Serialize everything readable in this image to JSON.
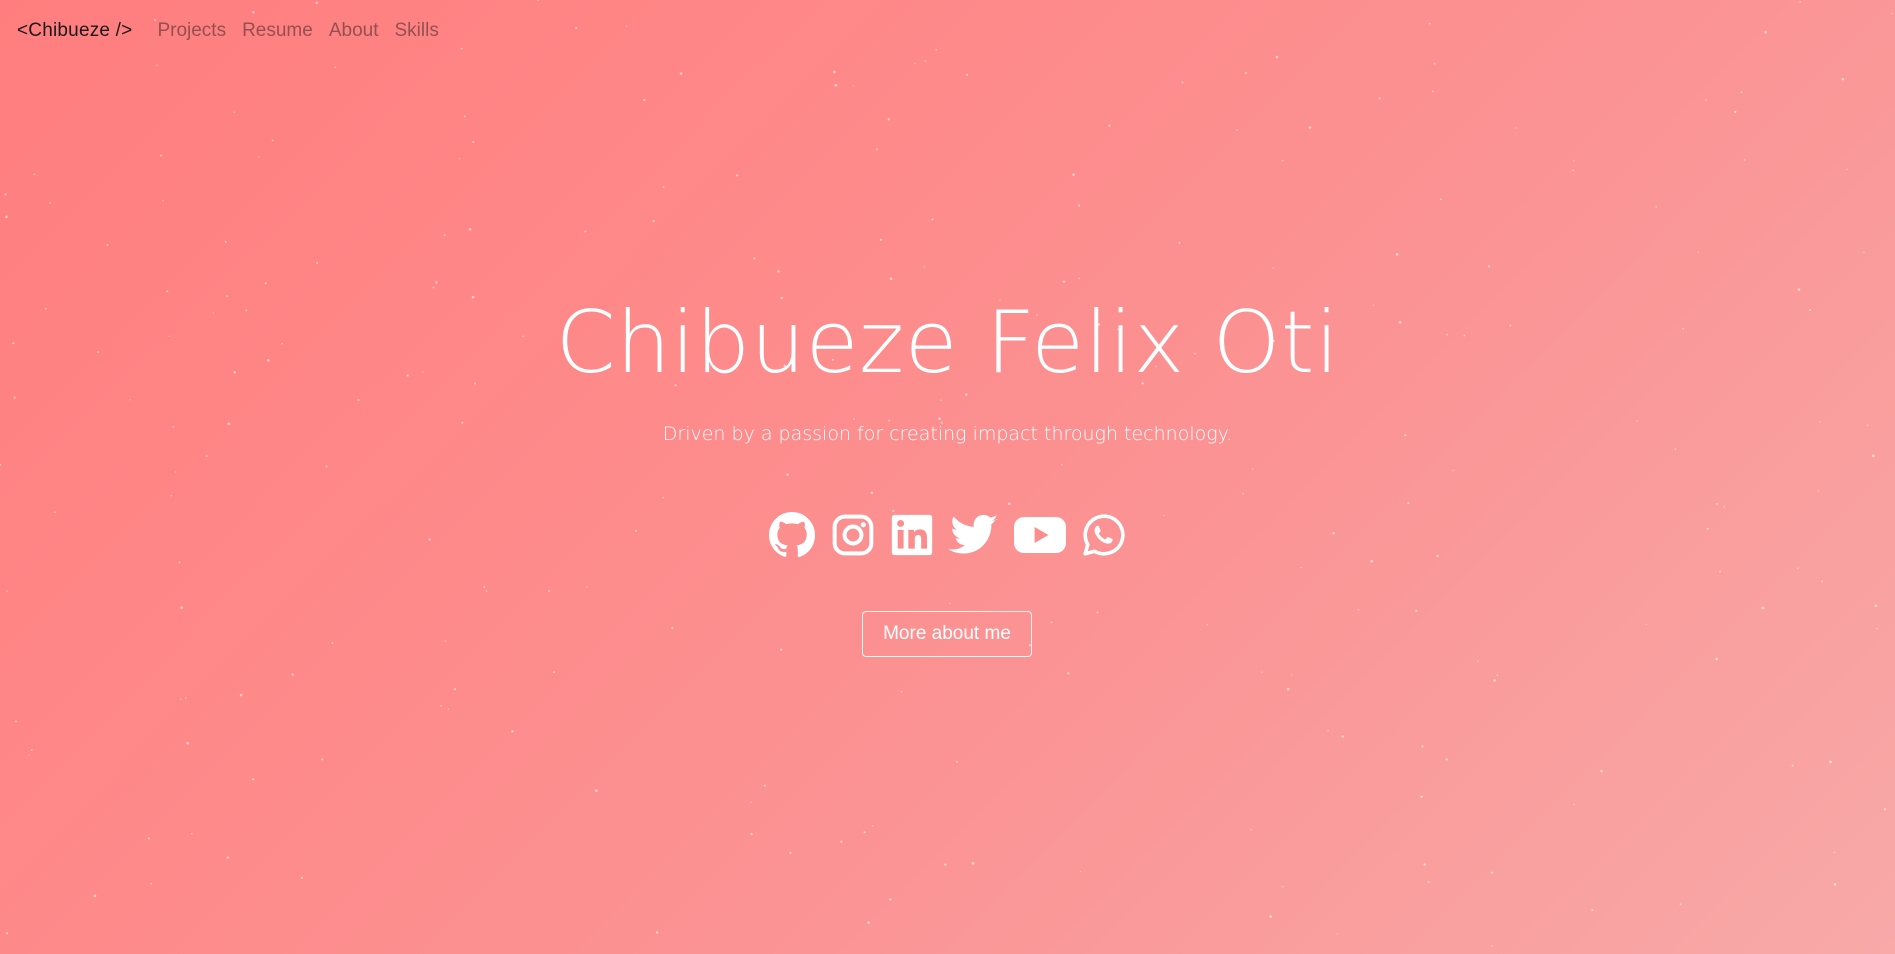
{
  "navbar": {
    "brand": "<Chibueze />",
    "links": [
      "Projects",
      "Resume",
      "About",
      "Skills"
    ]
  },
  "hero": {
    "name": "Chibueze Felix Oti",
    "tagline": "Driven by a passion for creating impact through technology.",
    "cta_label": "More about me",
    "socials": [
      "github-icon",
      "instagram-icon",
      "linkedin-icon",
      "twitter-icon",
      "youtube-icon",
      "whatsapp-icon"
    ]
  },
  "colors": {
    "background_start": "#ff7d7e",
    "background_end": "#f8a9a8",
    "text": "#ffffff",
    "brand": "#1a1a1a"
  }
}
